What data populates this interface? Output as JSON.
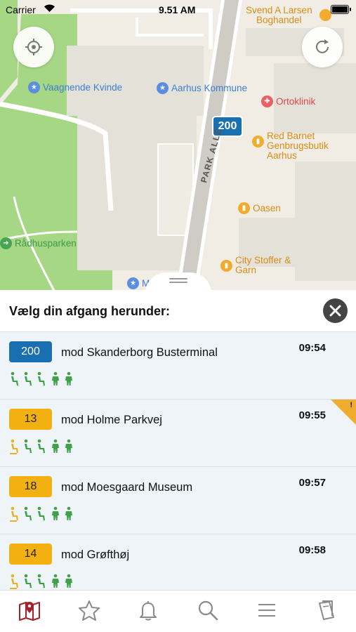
{
  "status_bar": {
    "carrier": "Carrier",
    "time": "9.51 AM"
  },
  "map": {
    "route_badge": "200",
    "street_label": "PARK ALLÉ",
    "pois": [
      {
        "name": "Svend A Larsen\nBoghandel",
        "color": "orange"
      },
      {
        "name": "Vaagnende Kvinde",
        "color": "blue"
      },
      {
        "name": "Aarhus Kommune",
        "color": "blue"
      },
      {
        "name": "Ortoklinik",
        "color": "red"
      },
      {
        "name": "Red Barnet\nGenbrugsbutik\nAarhus",
        "color": "orange"
      },
      {
        "name": "Oasen",
        "color": "orange"
      },
      {
        "name": "Rådhusparken",
        "color": "green"
      },
      {
        "name": "City Stoffer &\nGarn",
        "color": "orange"
      },
      {
        "name": "Mi",
        "color": "blue"
      }
    ]
  },
  "sheet": {
    "title": "Vælg din afgang herunder:",
    "departures": [
      {
        "line": "200",
        "destination": "mod Skanderborg Busterminal",
        "time": "09:54",
        "badge_color": "#1a6fb0",
        "badge_text_color": "#ffffff",
        "occupancy_level": 3,
        "warning": false
      },
      {
        "line": "13",
        "destination": "mod Holme Parkvej",
        "time": "09:55",
        "badge_color": "#f2b110",
        "badge_text_color": "#222222",
        "occupancy_level": 1,
        "warning": true
      },
      {
        "line": "18",
        "destination": "mod Moesgaard Museum",
        "time": "09:57",
        "badge_color": "#f2b110",
        "badge_text_color": "#222222",
        "occupancy_level": 1,
        "warning": false
      },
      {
        "line": "14",
        "destination": "mod Grøfthøj",
        "time": "09:58",
        "badge_color": "#f2b110",
        "badge_text_color": "#222222",
        "occupancy_level": 1,
        "warning": false
      }
    ]
  },
  "tabbar": {
    "tabs": [
      {
        "icon": "map-pin-icon",
        "active": true
      },
      {
        "icon": "star-icon",
        "active": false
      },
      {
        "icon": "bell-icon",
        "active": false
      },
      {
        "icon": "search-icon",
        "active": false
      },
      {
        "icon": "menu-icon",
        "active": false
      },
      {
        "icon": "tickets-icon",
        "active": false
      }
    ]
  },
  "colors": {
    "active_tab": "#a8202a",
    "inactive_tab": "#8a8a8a",
    "occupancy_green": "#3fa14a",
    "occupancy_yellow": "#e8b22a"
  }
}
